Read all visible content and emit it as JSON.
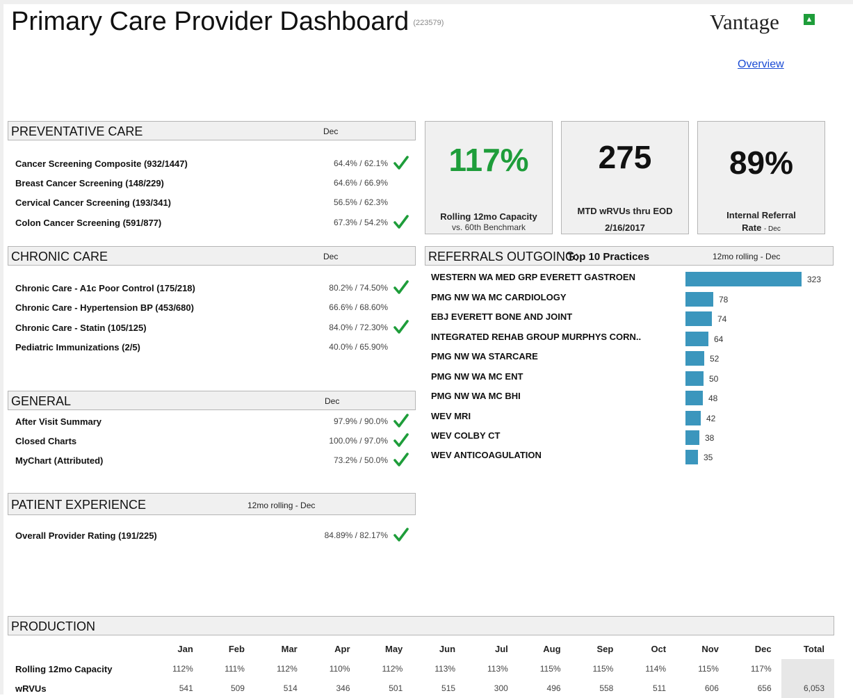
{
  "header": {
    "title": "Primary Care Provider Dashboard",
    "provider_id": "(223579)",
    "brand": "Vantage",
    "overview_link": "Overview"
  },
  "colors": {
    "accent_green": "#1e9d3a",
    "bar_blue": "#3b96bd",
    "header_gray": "#f0f0f0",
    "check_green": "#1e9d3a",
    "link_blue": "#1a4bd4"
  },
  "preventative": {
    "title": "PREVENTATIVE CARE",
    "period": "Dec",
    "items": [
      {
        "label": "Cancer Screening Composite (932/1447)",
        "value": "64.4% / 62.1%",
        "check": true
      },
      {
        "label": "Breast Cancer Screening (148/229)",
        "value": "64.6% / 66.9%",
        "check": false
      },
      {
        "label": "Cervical Cancer Screening (193/341)",
        "value": "56.5% / 62.3%",
        "check": false
      },
      {
        "label": "Colon Cancer Screening (591/877)",
        "value": "67.3% / 54.2%",
        "check": true
      }
    ]
  },
  "chronic": {
    "title": "CHRONIC CARE",
    "period": "Dec",
    "items": [
      {
        "label": "Chronic Care - A1c Poor Control (175/218)",
        "value": "80.2% / 74.50%",
        "check": true
      },
      {
        "label": "Chronic Care - Hypertension BP (453/680)",
        "value": "66.6% / 68.60%",
        "check": false
      },
      {
        "label": "Chronic Care - Statin (105/125)",
        "value": "84.0% / 72.30%",
        "check": true
      },
      {
        "label": "Pediatric Immunizations (2/5)",
        "value": "40.0% / 65.90%",
        "check": false
      }
    ]
  },
  "general": {
    "title": "GENERAL",
    "period": "Dec",
    "items": [
      {
        "label": "After Visit Summary",
        "value": "97.9% / 90.0%",
        "check": true
      },
      {
        "label": "Closed Charts",
        "value": "100.0% / 97.0%",
        "check": true
      },
      {
        "label": "MyChart (Attributed)",
        "value": "73.2% / 50.0%",
        "check": true
      }
    ]
  },
  "patient_experience": {
    "title": "PATIENT EXPERIENCE",
    "period": "12mo rolling - Dec",
    "items": [
      {
        "label": "Overall Provider Rating (191/225)",
        "value": "84.89% / 82.17%",
        "check": true
      }
    ]
  },
  "kpis": [
    {
      "value": "117%",
      "caption": "Rolling 12mo Capacity",
      "sub": "vs. 60th Benchmark",
      "color": "#1e9d3a"
    },
    {
      "value": "275",
      "caption": "MTD wRVUs thru EOD",
      "sub": "2/16/2017",
      "color": "#111111"
    },
    {
      "value": "89%",
      "caption": "Internal Referral",
      "sub": "Rate",
      "sub_small": "- Dec",
      "color": "#111111"
    }
  ],
  "referrals": {
    "title": "REFERRALS OUTGOING:",
    "subtitle": "Top 10 Practices",
    "period": "12mo rolling - Dec",
    "max": 323,
    "items": [
      {
        "label": "WESTERN WA MED GRP EVERETT GASTROEN",
        "value": 323
      },
      {
        "label": "PMG NW WA MC CARDIOLOGY",
        "value": 78
      },
      {
        "label": "EBJ EVERETT BONE AND JOINT",
        "value": 74
      },
      {
        "label": "INTEGRATED REHAB GROUP MURPHYS CORN..",
        "value": 64
      },
      {
        "label": "PMG NW WA STARCARE",
        "value": 52
      },
      {
        "label": "PMG NW WA MC ENT",
        "value": 50
      },
      {
        "label": "PMG NW WA MC BHI",
        "value": 48
      },
      {
        "label": "WEV MRI",
        "value": 42
      },
      {
        "label": "WEV COLBY CT",
        "value": 38
      },
      {
        "label": "WEV ANTICOAGULATION",
        "value": 35
      }
    ]
  },
  "production": {
    "title": "PRODUCTION",
    "columns": [
      "Jan",
      "Feb",
      "Mar",
      "Apr",
      "May",
      "Jun",
      "Jul",
      "Aug",
      "Sep",
      "Oct",
      "Nov",
      "Dec",
      "Total"
    ],
    "rows": [
      {
        "label": "Rolling 12mo Capacity",
        "values": [
          "112%",
          "111%",
          "112%",
          "110%",
          "112%",
          "113%",
          "113%",
          "115%",
          "115%",
          "114%",
          "115%",
          "117%",
          ""
        ]
      },
      {
        "label": "wRVUs",
        "values": [
          "541",
          "509",
          "514",
          "346",
          "501",
          "515",
          "300",
          "496",
          "558",
          "511",
          "606",
          "656",
          "6,053"
        ]
      }
    ]
  }
}
